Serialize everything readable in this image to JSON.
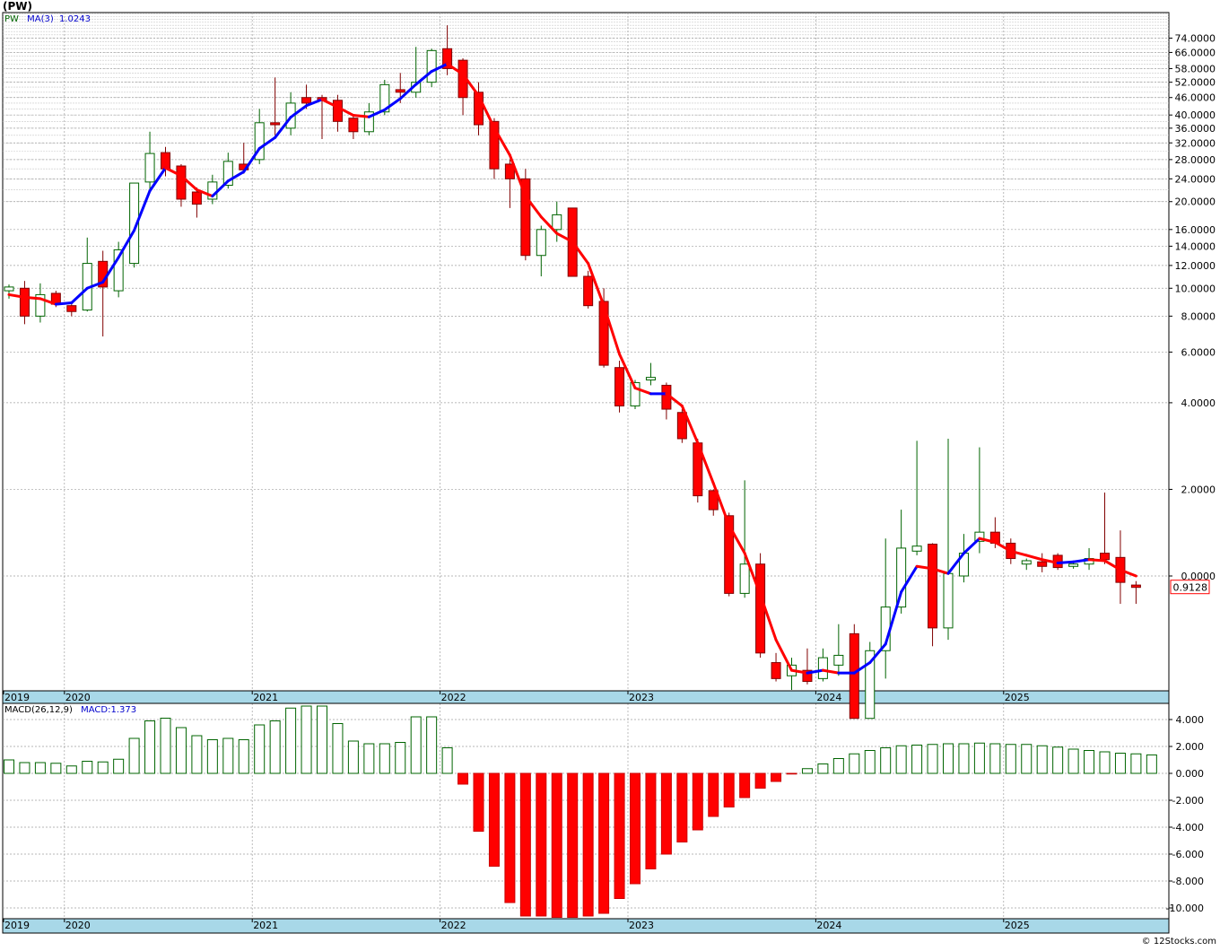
{
  "ticker": "(PW)",
  "price_legend": {
    "symbol": "PW",
    "ma_label": "MA(3)",
    "ma_value": "1.0243"
  },
  "macd_legend": {
    "label": "MACD(26,12,9)",
    "value": "MACD:1.373"
  },
  "last_price_tag": "0.9128",
  "credit": "© 12Stocks.com",
  "colors": {
    "up": "#006400",
    "down": "#ff0000",
    "ma_up": "#0000ff",
    "ma_down": "#ff0000",
    "axis_band": "#a8d8e8",
    "grid": "#a0a0a0"
  },
  "chart_data": [
    {
      "type": "candlestick",
      "title": "(PW)",
      "scale": "log",
      "x_labels": [
        "2019",
        "2020",
        "2021",
        "2022",
        "2023",
        "2024",
        "2025"
      ],
      "y_ticks": [
        "74.0000",
        "66.0000",
        "58.0000",
        "52.0000",
        "46.0000",
        "40.0000",
        "36.0000",
        "32.0000",
        "28.0000",
        "24.0000",
        "20.0000",
        "16.0000",
        "14.0000",
        "12.0000",
        "10.0000",
        "8.0000",
        "6.0000",
        "4.0000",
        "2.0000",
        "0.0000"
      ],
      "ma_label": "MA(3)",
      "last_value": 0.9128,
      "grid": true,
      "candles": [
        {
          "date": "2019-11",
          "open": 9.8,
          "high": 10.3,
          "low": 9.2,
          "close": 10.1
        },
        {
          "date": "2019-12",
          "open": 10.0,
          "high": 10.6,
          "low": 7.5,
          "close": 8.0
        },
        {
          "date": "2020-01",
          "open": 8.0,
          "high": 10.4,
          "low": 7.6,
          "close": 9.5
        },
        {
          "date": "2020-02",
          "open": 9.6,
          "high": 9.8,
          "low": 8.6,
          "close": 8.8
        },
        {
          "date": "2020-03",
          "open": 8.7,
          "high": 9.0,
          "low": 8.0,
          "close": 8.3
        },
        {
          "date": "2020-04",
          "open": 8.4,
          "high": 15.0,
          "low": 8.3,
          "close": 12.2
        },
        {
          "date": "2020-05",
          "open": 12.4,
          "high": 13.5,
          "low": 6.8,
          "close": 10.1
        },
        {
          "date": "2020-06",
          "open": 9.8,
          "high": 14.5,
          "low": 9.3,
          "close": 13.6
        },
        {
          "date": "2020-07",
          "open": 12.2,
          "high": 23.2,
          "low": 11.8,
          "close": 23.2
        },
        {
          "date": "2020-08",
          "open": 23.4,
          "high": 35.0,
          "low": 22.0,
          "close": 29.4
        },
        {
          "date": "2020-09",
          "open": 29.6,
          "high": 31.0,
          "low": 24.5,
          "close": 26.0
        },
        {
          "date": "2020-10",
          "open": 26.6,
          "high": 27.0,
          "low": 19.2,
          "close": 20.4
        },
        {
          "date": "2020-11",
          "open": 21.6,
          "high": 22.4,
          "low": 17.6,
          "close": 19.6
        },
        {
          "date": "2020-12",
          "open": 20.4,
          "high": 24.8,
          "low": 19.6,
          "close": 23.4
        },
        {
          "date": "2021-01",
          "open": 22.8,
          "high": 29.6,
          "low": 22.2,
          "close": 27.6
        },
        {
          "date": "2021-02",
          "open": 27.0,
          "high": 32.0,
          "low": 25.0,
          "close": 25.8
        },
        {
          "date": "2021-03",
          "open": 28.0,
          "high": 42.0,
          "low": 27.0,
          "close": 37.6
        },
        {
          "date": "2021-04",
          "open": 37.6,
          "high": 54.0,
          "low": 34.0,
          "close": 37.0
        },
        {
          "date": "2021-05",
          "open": 36.0,
          "high": 48.0,
          "low": 34.0,
          "close": 44.0
        },
        {
          "date": "2021-06",
          "open": 46.0,
          "high": 51.0,
          "low": 42.0,
          "close": 44.0
        },
        {
          "date": "2021-07",
          "open": 46.0,
          "high": 47.0,
          "low": 33.0,
          "close": 45.0
        },
        {
          "date": "2021-08",
          "open": 45.0,
          "high": 47.0,
          "low": 35.0,
          "close": 38.0
        },
        {
          "date": "2021-09",
          "open": 39.0,
          "high": 40.0,
          "low": 33.0,
          "close": 35.0
        },
        {
          "date": "2021-10",
          "open": 35.0,
          "high": 44.0,
          "low": 34.0,
          "close": 41.0
        },
        {
          "date": "2021-11",
          "open": 41.0,
          "high": 53.0,
          "low": 40.0,
          "close": 51.0
        },
        {
          "date": "2021-12",
          "open": 49.0,
          "high": 56.0,
          "low": 44.0,
          "close": 48.0
        },
        {
          "date": "2022-01",
          "open": 48.0,
          "high": 69.0,
          "low": 46.0,
          "close": 52.0
        },
        {
          "date": "2022-02",
          "open": 52.0,
          "high": 68.0,
          "low": 50.0,
          "close": 67.0
        },
        {
          "date": "2022-03",
          "open": 68.0,
          "high": 82.0,
          "low": 55.0,
          "close": 58.0
        },
        {
          "date": "2022-04",
          "open": 62.0,
          "high": 63.0,
          "low": 40.0,
          "close": 46.0
        },
        {
          "date": "2022-05",
          "open": 48.0,
          "high": 52.0,
          "low": 34.0,
          "close": 37.0
        },
        {
          "date": "2022-06",
          "open": 38.0,
          "high": 39.0,
          "low": 24.0,
          "close": 26.0
        },
        {
          "date": "2022-07",
          "open": 27.0,
          "high": 28.0,
          "low": 19.0,
          "close": 24.0
        },
        {
          "date": "2022-08",
          "open": 24.0,
          "high": 26.0,
          "low": 12.5,
          "close": 13.0
        },
        {
          "date": "2022-09",
          "open": 13.0,
          "high": 16.5,
          "low": 11.0,
          "close": 16.0
        },
        {
          "date": "2022-10",
          "open": 16.0,
          "high": 20.0,
          "low": 14.5,
          "close": 18.0
        },
        {
          "date": "2022-11",
          "open": 19.0,
          "high": 19.0,
          "low": 11.0,
          "close": 11.0
        },
        {
          "date": "2022-12",
          "open": 11.0,
          "high": 11.5,
          "low": 8.5,
          "close": 8.7
        },
        {
          "date": "2023-01",
          "open": 9.0,
          "high": 10.0,
          "low": 5.3,
          "close": 5.4
        },
        {
          "date": "2023-02",
          "open": 5.3,
          "high": 5.6,
          "low": 3.7,
          "close": 3.9
        },
        {
          "date": "2023-03",
          "open": 3.9,
          "high": 4.8,
          "low": 3.8,
          "close": 4.7
        },
        {
          "date": "2023-04",
          "open": 4.8,
          "high": 5.5,
          "low": 4.6,
          "close": 4.9
        },
        {
          "date": "2023-05",
          "open": 4.6,
          "high": 4.7,
          "low": 3.5,
          "close": 3.8
        },
        {
          "date": "2023-06",
          "open": 3.7,
          "high": 3.8,
          "low": 2.9,
          "close": 3.0
        },
        {
          "date": "2023-07",
          "open": 2.9,
          "high": 3.0,
          "low": 1.8,
          "close": 1.9
        },
        {
          "date": "2023-08",
          "open": 1.98,
          "high": 2.0,
          "low": 1.62,
          "close": 1.7
        },
        {
          "date": "2023-09",
          "open": 1.62,
          "high": 1.66,
          "low": 0.85,
          "close": 0.87
        },
        {
          "date": "2023-10",
          "open": 0.87,
          "high": 2.15,
          "low": 0.84,
          "close": 1.1
        },
        {
          "date": "2023-11",
          "open": 1.1,
          "high": 1.2,
          "low": 0.52,
          "close": 0.54
        },
        {
          "date": "2023-12",
          "open": 0.5,
          "high": 0.54,
          "low": 0.43,
          "close": 0.44
        },
        {
          "date": "2024-01",
          "open": 0.45,
          "high": 0.52,
          "low": 0.36,
          "close": 0.49
        },
        {
          "date": "2024-02",
          "open": 0.47,
          "high": 0.56,
          "low": 0.42,
          "close": 0.43
        },
        {
          "date": "2024-03",
          "open": 0.44,
          "high": 0.56,
          "low": 0.43,
          "close": 0.52
        },
        {
          "date": "2024-04",
          "open": 0.49,
          "high": 0.68,
          "low": 0.45,
          "close": 0.53
        },
        {
          "date": "2024-05",
          "open": 0.63,
          "high": 0.68,
          "low": 0.26,
          "close": 0.32
        },
        {
          "date": "2024-06",
          "open": 0.32,
          "high": 0.59,
          "low": 0.25,
          "close": 0.55
        },
        {
          "date": "2024-07",
          "open": 0.55,
          "high": 1.35,
          "low": 0.44,
          "close": 0.78
        },
        {
          "date": "2024-08",
          "open": 0.78,
          "high": 1.7,
          "low": 0.74,
          "close": 1.25
        },
        {
          "date": "2024-09",
          "open": 1.22,
          "high": 2.95,
          "low": 1.18,
          "close": 1.27
        },
        {
          "date": "2024-10",
          "open": 1.29,
          "high": 1.3,
          "low": 0.57,
          "close": 0.66
        },
        {
          "date": "2024-11",
          "open": 0.66,
          "high": 3.0,
          "low": 0.6,
          "close": 1.02
        },
        {
          "date": "2024-12",
          "open": 1.0,
          "high": 1.4,
          "low": 0.95,
          "close": 1.2
        },
        {
          "date": "2025-01",
          "open": 1.32,
          "high": 2.8,
          "low": 1.2,
          "close": 1.42
        },
        {
          "date": "2025-02",
          "open": 1.42,
          "high": 1.6,
          "low": 1.25,
          "close": 1.3
        },
        {
          "date": "2025-03",
          "open": 1.3,
          "high": 1.35,
          "low": 1.1,
          "close": 1.15
        },
        {
          "date": "2025-04",
          "open": 1.1,
          "high": 1.15,
          "low": 1.05,
          "close": 1.13
        },
        {
          "date": "2025-05",
          "open": 1.12,
          "high": 1.2,
          "low": 1.03,
          "close": 1.08
        },
        {
          "date": "2025-06",
          "open": 1.18,
          "high": 1.2,
          "low": 1.05,
          "close": 1.07
        },
        {
          "date": "2025-07",
          "open": 1.08,
          "high": 1.12,
          "low": 1.06,
          "close": 1.1
        },
        {
          "date": "2025-08",
          "open": 1.1,
          "high": 1.25,
          "low": 1.05,
          "close": 1.15
        },
        {
          "date": "2025-09",
          "open": 1.2,
          "high": 1.95,
          "low": 1.1,
          "close": 1.14
        },
        {
          "date": "2025-10",
          "open": 1.16,
          "high": 1.44,
          "low": 0.8,
          "close": 0.95
        },
        {
          "date": "2025-11",
          "open": 0.93,
          "high": 0.96,
          "low": 0.8,
          "close": 0.9128
        }
      ],
      "ma3": [
        9.5,
        9.3,
        9.2,
        8.8,
        8.9,
        10.0,
        10.5,
        12.8,
        15.9,
        21.8,
        26.2,
        24.6,
        22.0,
        20.9,
        23.6,
        25.4,
        30.6,
        33.4,
        39.3,
        43.1,
        45.3,
        42.6,
        39.9,
        39.4,
        41.7,
        45.6,
        51.1,
        56.7,
        60.2,
        55.4,
        46.7,
        36.1,
        29.0,
        20.9,
        17.7,
        15.5,
        14.5,
        12.2,
        8.7,
        5.9,
        4.5,
        4.3,
        4.3,
        3.9,
        2.9,
        2.1,
        1.5,
        1.2,
        0.86,
        0.6,
        0.47,
        0.46,
        0.47,
        0.46,
        0.46,
        0.5,
        0.58,
        0.88,
        1.08,
        1.06,
        1.02,
        1.2,
        1.35,
        1.31,
        1.22,
        1.18,
        1.14,
        1.11,
        1.12,
        1.14,
        1.13,
        1.05,
        1.0
      ]
    },
    {
      "type": "bar",
      "title": "MACD(26,12,9)",
      "legend_value": "MACD:1.373",
      "x_labels": [
        "2019",
        "2020",
        "2021",
        "2022",
        "2023",
        "2024",
        "2025"
      ],
      "y_ticks": [
        "4.000",
        "2.000",
        "0.000",
        "-2.000",
        "-4.000",
        "-6.000",
        "-8.000",
        "-10.000"
      ],
      "ylim": [
        -10.8,
        5.2
      ],
      "values": [
        1.0,
        0.8,
        0.8,
        0.75,
        0.55,
        0.9,
        0.85,
        1.05,
        2.6,
        3.9,
        4.1,
        3.4,
        2.8,
        2.5,
        2.6,
        2.5,
        3.6,
        3.9,
        4.85,
        5.0,
        5.0,
        3.7,
        2.4,
        2.2,
        2.2,
        2.3,
        4.2,
        4.2,
        1.9,
        -0.8,
        -4.3,
        -6.9,
        -9.6,
        -10.6,
        -10.6,
        -10.7,
        -10.7,
        -10.6,
        -10.4,
        -9.3,
        -8.2,
        -7.1,
        -6.0,
        -5.1,
        -4.2,
        -3.2,
        -2.5,
        -1.8,
        -1.1,
        -0.6,
        -0.05,
        0.35,
        0.7,
        1.1,
        1.45,
        1.7,
        1.9,
        2.05,
        2.1,
        2.15,
        2.2,
        2.2,
        2.25,
        2.2,
        2.15,
        2.15,
        2.05,
        1.95,
        1.8,
        1.7,
        1.6,
        1.5,
        1.45,
        1.37
      ]
    }
  ]
}
